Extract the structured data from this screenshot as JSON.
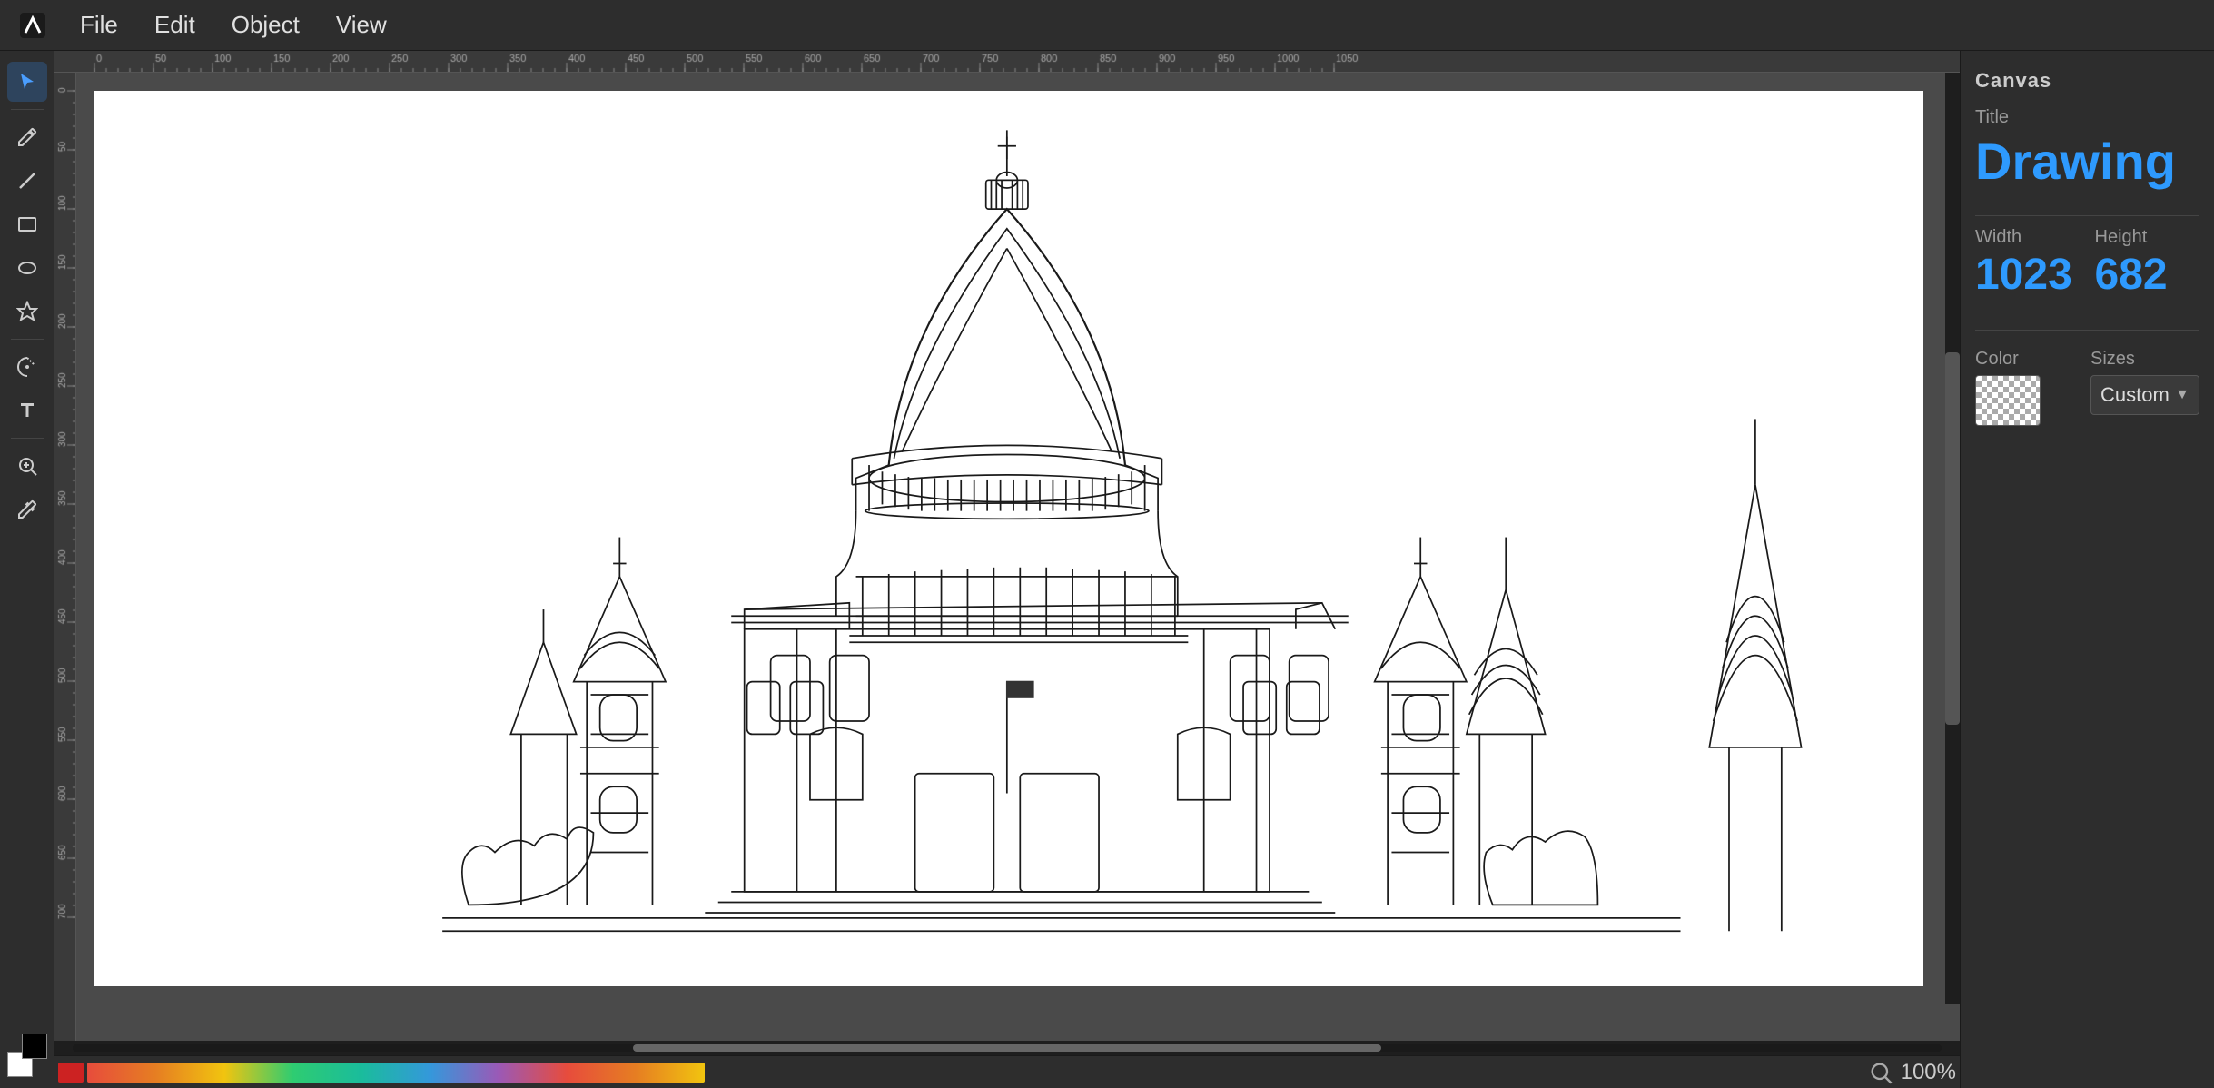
{
  "menubar": {
    "menus": [
      "File",
      "Edit",
      "Object",
      "View"
    ]
  },
  "toolbar": {
    "tools": [
      {
        "name": "select-tool",
        "label": "Select",
        "icon": "arrow",
        "active": true
      },
      {
        "name": "pencil-tool",
        "label": "Pencil",
        "icon": "pencil",
        "active": false
      },
      {
        "name": "line-tool",
        "label": "Line",
        "icon": "line",
        "active": false
      },
      {
        "name": "rectangle-tool",
        "label": "Rectangle",
        "icon": "rect",
        "active": false
      },
      {
        "name": "ellipse-tool",
        "label": "Ellipse",
        "icon": "ellipse",
        "active": false
      },
      {
        "name": "star-tool",
        "label": "Star",
        "icon": "star",
        "active": false
      },
      {
        "name": "pen-tool",
        "label": "Pen",
        "icon": "pen",
        "active": false
      },
      {
        "name": "text-tool",
        "label": "Text",
        "icon": "text",
        "active": false
      },
      {
        "name": "zoom-tool",
        "label": "Zoom",
        "icon": "zoom",
        "active": false
      },
      {
        "name": "dropper-tool",
        "label": "Dropper",
        "icon": "dropper",
        "active": false
      }
    ]
  },
  "canvas": {
    "panel_title": "Canvas",
    "title_label": "Title",
    "title_value": "Drawing",
    "width_label": "Width",
    "width_value": "1023",
    "height_label": "Height",
    "height_value": "682",
    "color_label": "Color",
    "sizes_label": "Sizes",
    "sizes_value": "Custom"
  },
  "zoom": {
    "level": "100%",
    "icon": "magnify"
  }
}
